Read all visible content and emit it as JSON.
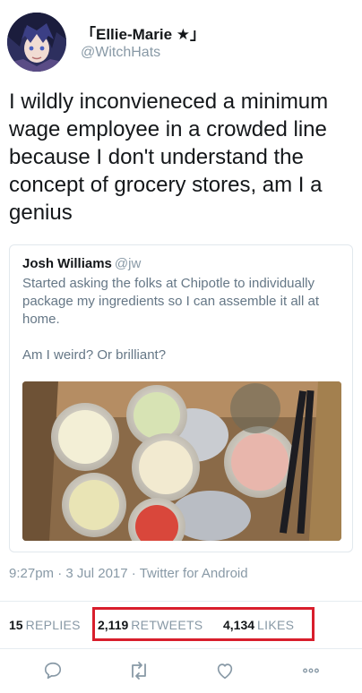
{
  "author": {
    "display_name": "「Ellie-Marie ★」",
    "handle": "@WitchHats"
  },
  "tweet_text": "I wildly inconvieneced a minimum wage employee in a crowded line because I don't understand the concept of grocery stores, am I a genius",
  "quoted": {
    "name": "Josh Williams",
    "handle": "@jw",
    "text_p1": "Started asking the folks at Chipotle to individually package my ingredients so I can assemble it all at home.",
    "text_p2": "Am I weird? Or brilliant?"
  },
  "meta": {
    "time": "9:27pm",
    "date": "3 Jul 2017",
    "source": "Twitter for Android",
    "separator": "·"
  },
  "stats": {
    "replies_count": "15",
    "replies_label": "REPLIES",
    "retweets_count": "2,119",
    "retweets_label": "RETWEETS",
    "likes_count": "4,134",
    "likes_label": "LIKES"
  },
  "actions": [
    "reply-icon",
    "retweet-icon",
    "like-icon",
    "more-icon"
  ],
  "colors": {
    "secondary_text": "#8899a6",
    "highlight_box": "#d81e2c",
    "divider": "#e6ecf0"
  }
}
